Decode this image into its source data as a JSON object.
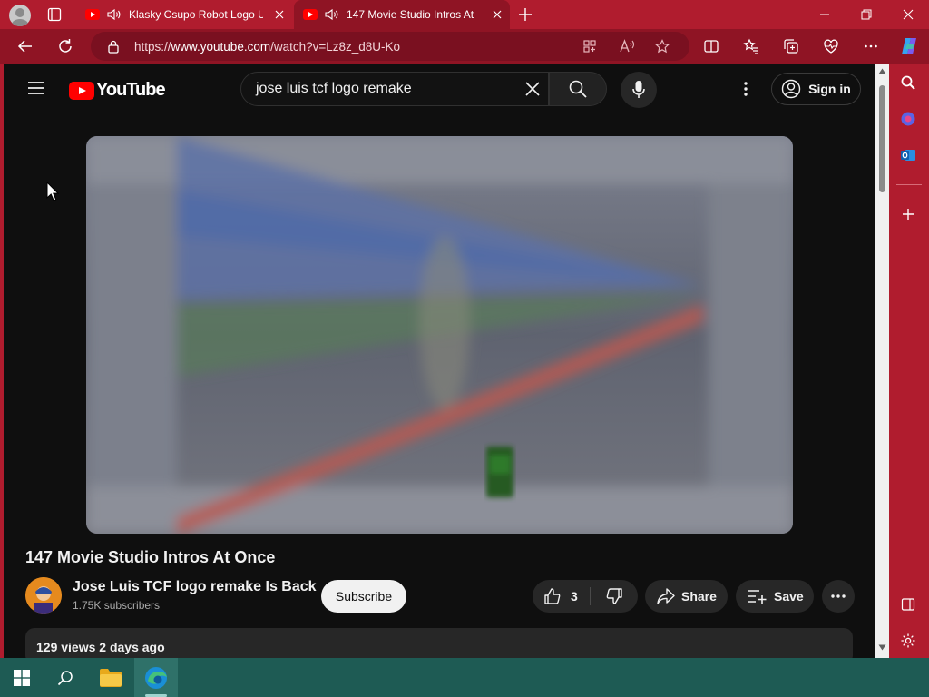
{
  "browser": {
    "tabs": [
      {
        "title": "Klasky Csupo Robot Logo U",
        "active": false
      },
      {
        "title": "147 Movie Studio Intros At",
        "active": true
      }
    ],
    "url_prefix": "https://",
    "url_domain": "www.youtube.com",
    "url_path": "/watch?v=Lz8z_d8U-Ko"
  },
  "youtube": {
    "logo_text": "YouTube",
    "search_value": "jose luis tcf logo remake",
    "sign_in_label": "Sign in"
  },
  "video": {
    "title": "147 Movie Studio Intros At Once",
    "channel_name": "Jose Luis TCF logo remake Is Back",
    "subscribers": "1.75K subscribers",
    "subscribe_label": "Subscribe",
    "like_count": "3",
    "share_label": "Share",
    "save_label": "Save",
    "views": "129 views",
    "posted": "2 days ago"
  },
  "colors": {
    "browser_frame": "#b01c2e",
    "page_background": "#0f0f0f",
    "youtube_red": "#ff0000",
    "taskbar": "#1e5b54"
  }
}
